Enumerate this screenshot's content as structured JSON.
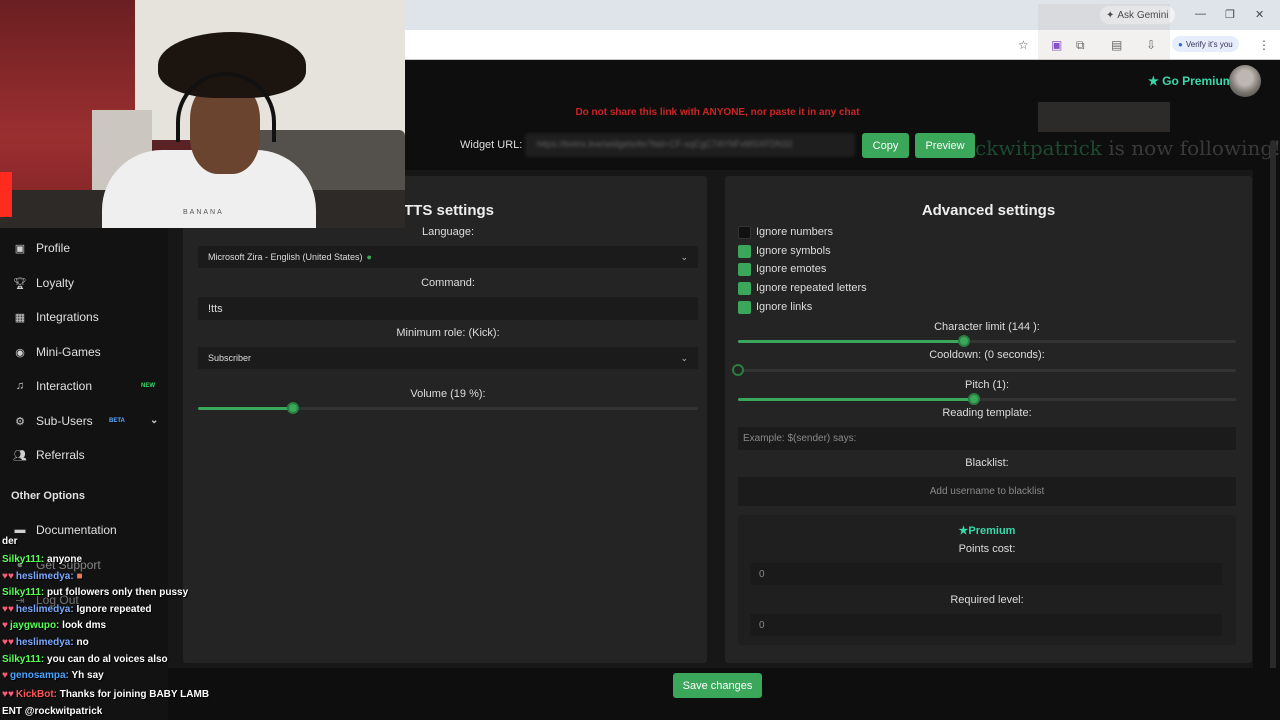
{
  "browser": {
    "ask_gemini": "Ask Gemini",
    "verify": "Verify it's you"
  },
  "header": {
    "go_premium": "Go Premium"
  },
  "widget": {
    "warning": "Do not share this link with ANYONE, nor paste it in any chat",
    "label": "Widget URL:",
    "url": "https://botrix.live/widgets/tts?bid=CF-xqCgC7AYNFvMSXFDN32",
    "copy": "Copy",
    "preview": "Preview",
    "alert_user": "ckwitpatrick",
    "alert_text": " is now following!"
  },
  "sidebar": {
    "items": [
      {
        "label": "Profile",
        "icon": "profile-icon"
      },
      {
        "label": "Loyalty",
        "icon": "trophy-icon"
      },
      {
        "label": "Integrations",
        "icon": "integrations-icon"
      },
      {
        "label": "Mini-Games",
        "icon": "gamepad-icon"
      },
      {
        "label": "Interaction",
        "icon": "music-icon",
        "tag": "NEW"
      },
      {
        "label": "Sub-Users",
        "icon": "users-icon",
        "tag": "BETA"
      },
      {
        "label": "Referrals",
        "icon": "referrals-icon"
      }
    ],
    "other_options": "Other Options",
    "other_items": [
      {
        "label": "Documentation",
        "icon": "book-icon"
      },
      {
        "label": "Get Support",
        "icon": "support-icon"
      },
      {
        "label": "Log Out",
        "icon": "logout-icon"
      }
    ]
  },
  "tts": {
    "title": "TTS settings",
    "language_label": "Language:",
    "language_value": "Microsoft Zira - English (United States)",
    "command_label": "Command:",
    "command_value": "!tts",
    "min_role_label": "Minimum role: (Kick):",
    "min_role_value": "Subscriber",
    "volume_label": "Volume (19 %):",
    "volume": 19
  },
  "advanced": {
    "title": "Advanced settings",
    "options": [
      {
        "label": "Ignore numbers",
        "checked": false
      },
      {
        "label": "Ignore symbols",
        "checked": true
      },
      {
        "label": "Ignore emotes",
        "checked": true
      },
      {
        "label": "Ignore repeated letters",
        "checked": true
      },
      {
        "label": "Ignore links",
        "checked": true
      }
    ],
    "char_limit_label": "Character limit (144 ):",
    "char_limit": 144,
    "cooldown_label": "Cooldown: (0 seconds):",
    "cooldown": 0,
    "pitch_label": "Pitch (1):",
    "pitch": 1,
    "reading_template_label": "Reading template:",
    "reading_template_placeholder": "Example: $(sender) says:",
    "blacklist_label": "Blacklist:",
    "blacklist_placeholder": "Add username to blacklist",
    "premium_label": "Premium",
    "points_cost_label": "Points cost:",
    "points_cost": "0",
    "required_level_label": "Required level:",
    "required_level": "0"
  },
  "save_button": "Save changes",
  "webcam": {
    "shirt_text": "BANANA"
  },
  "chat": {
    "lines": [
      {
        "user": "",
        "msg": "der",
        "color": "#ffffff"
      },
      {
        "user": "Silky111:",
        "msg": "anyone",
        "color": "#55ff55"
      },
      {
        "user": "heslimedya:",
        "msg": "",
        "color": "#7aa8ff"
      },
      {
        "user": "Silky111:",
        "msg": "put followers only then pussy",
        "color": "#55ff55"
      },
      {
        "user": "heslimedya:",
        "msg": "Ignore repeated",
        "color": "#7aa8ff"
      },
      {
        "user": "jaygwupo:",
        "msg": "look dms",
        "color": "#55ff55"
      },
      {
        "user": "heslimedya:",
        "msg": "no",
        "color": "#7aa8ff"
      },
      {
        "user": "Silky111:",
        "msg": "you can do al voices also",
        "color": "#55ff55"
      },
      {
        "user": "genosampa:",
        "msg": "Yh say",
        "color": "#4aa3ff"
      },
      {
        "user": "KickBot:",
        "msg": "Thanks for joining BABY LAMB",
        "color": "#ff5555"
      },
      {
        "user": "",
        "msg": "ENT @rockwitpatrick",
        "color": "#ffffff"
      }
    ]
  },
  "colors": {
    "accent": "#3aa75a",
    "warning": "#cc2424",
    "premium": "#38d9a9"
  }
}
